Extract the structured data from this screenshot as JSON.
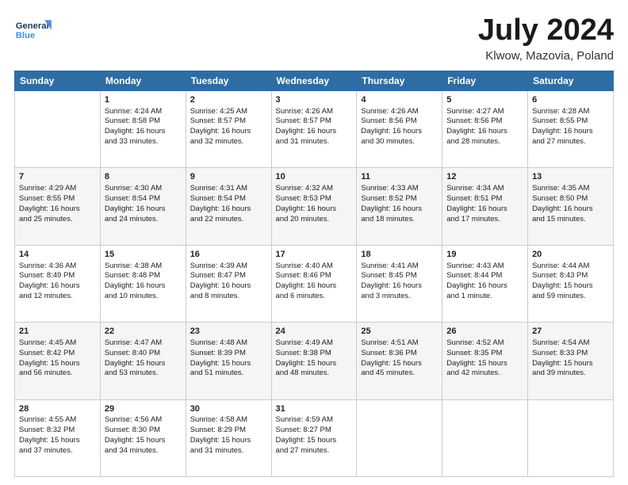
{
  "header": {
    "logo_line1": "General",
    "logo_line2": "Blue",
    "title": "July 2024",
    "location": "Klwow, Mazovia, Poland"
  },
  "weekdays": [
    "Sunday",
    "Monday",
    "Tuesday",
    "Wednesday",
    "Thursday",
    "Friday",
    "Saturday"
  ],
  "weeks": [
    [
      {
        "day": "",
        "content": ""
      },
      {
        "day": "1",
        "content": "Sunrise: 4:24 AM\nSunset: 8:58 PM\nDaylight: 16 hours\nand 33 minutes."
      },
      {
        "day": "2",
        "content": "Sunrise: 4:25 AM\nSunset: 8:57 PM\nDaylight: 16 hours\nand 32 minutes."
      },
      {
        "day": "3",
        "content": "Sunrise: 4:26 AM\nSunset: 8:57 PM\nDaylight: 16 hours\nand 31 minutes."
      },
      {
        "day": "4",
        "content": "Sunrise: 4:26 AM\nSunset: 8:56 PM\nDaylight: 16 hours\nand 30 minutes."
      },
      {
        "day": "5",
        "content": "Sunrise: 4:27 AM\nSunset: 8:56 PM\nDaylight: 16 hours\nand 28 minutes."
      },
      {
        "day": "6",
        "content": "Sunrise: 4:28 AM\nSunset: 8:55 PM\nDaylight: 16 hours\nand 27 minutes."
      }
    ],
    [
      {
        "day": "7",
        "content": "Sunrise: 4:29 AM\nSunset: 8:55 PM\nDaylight: 16 hours\nand 25 minutes."
      },
      {
        "day": "8",
        "content": "Sunrise: 4:30 AM\nSunset: 8:54 PM\nDaylight: 16 hours\nand 24 minutes."
      },
      {
        "day": "9",
        "content": "Sunrise: 4:31 AM\nSunset: 8:54 PM\nDaylight: 16 hours\nand 22 minutes."
      },
      {
        "day": "10",
        "content": "Sunrise: 4:32 AM\nSunset: 8:53 PM\nDaylight: 16 hours\nand 20 minutes."
      },
      {
        "day": "11",
        "content": "Sunrise: 4:33 AM\nSunset: 8:52 PM\nDaylight: 16 hours\nand 18 minutes."
      },
      {
        "day": "12",
        "content": "Sunrise: 4:34 AM\nSunset: 8:51 PM\nDaylight: 16 hours\nand 17 minutes."
      },
      {
        "day": "13",
        "content": "Sunrise: 4:35 AM\nSunset: 8:50 PM\nDaylight: 16 hours\nand 15 minutes."
      }
    ],
    [
      {
        "day": "14",
        "content": "Sunrise: 4:36 AM\nSunset: 8:49 PM\nDaylight: 16 hours\nand 12 minutes."
      },
      {
        "day": "15",
        "content": "Sunrise: 4:38 AM\nSunset: 8:48 PM\nDaylight: 16 hours\nand 10 minutes."
      },
      {
        "day": "16",
        "content": "Sunrise: 4:39 AM\nSunset: 8:47 PM\nDaylight: 16 hours\nand 8 minutes."
      },
      {
        "day": "17",
        "content": "Sunrise: 4:40 AM\nSunset: 8:46 PM\nDaylight: 16 hours\nand 6 minutes."
      },
      {
        "day": "18",
        "content": "Sunrise: 4:41 AM\nSunset: 8:45 PM\nDaylight: 16 hours\nand 3 minutes."
      },
      {
        "day": "19",
        "content": "Sunrise: 4:43 AM\nSunset: 8:44 PM\nDaylight: 16 hours\nand 1 minute."
      },
      {
        "day": "20",
        "content": "Sunrise: 4:44 AM\nSunset: 8:43 PM\nDaylight: 15 hours\nand 59 minutes."
      }
    ],
    [
      {
        "day": "21",
        "content": "Sunrise: 4:45 AM\nSunset: 8:42 PM\nDaylight: 15 hours\nand 56 minutes."
      },
      {
        "day": "22",
        "content": "Sunrise: 4:47 AM\nSunset: 8:40 PM\nDaylight: 15 hours\nand 53 minutes."
      },
      {
        "day": "23",
        "content": "Sunrise: 4:48 AM\nSunset: 8:39 PM\nDaylight: 15 hours\nand 51 minutes."
      },
      {
        "day": "24",
        "content": "Sunrise: 4:49 AM\nSunset: 8:38 PM\nDaylight: 15 hours\nand 48 minutes."
      },
      {
        "day": "25",
        "content": "Sunrise: 4:51 AM\nSunset: 8:36 PM\nDaylight: 15 hours\nand 45 minutes."
      },
      {
        "day": "26",
        "content": "Sunrise: 4:52 AM\nSunset: 8:35 PM\nDaylight: 15 hours\nand 42 minutes."
      },
      {
        "day": "27",
        "content": "Sunrise: 4:54 AM\nSunset: 8:33 PM\nDaylight: 15 hours\nand 39 minutes."
      }
    ],
    [
      {
        "day": "28",
        "content": "Sunrise: 4:55 AM\nSunset: 8:32 PM\nDaylight: 15 hours\nand 37 minutes."
      },
      {
        "day": "29",
        "content": "Sunrise: 4:56 AM\nSunset: 8:30 PM\nDaylight: 15 hours\nand 34 minutes."
      },
      {
        "day": "30",
        "content": "Sunrise: 4:58 AM\nSunset: 8:29 PM\nDaylight: 15 hours\nand 31 minutes."
      },
      {
        "day": "31",
        "content": "Sunrise: 4:59 AM\nSunset: 8:27 PM\nDaylight: 15 hours\nand 27 minutes."
      },
      {
        "day": "",
        "content": ""
      },
      {
        "day": "",
        "content": ""
      },
      {
        "day": "",
        "content": ""
      }
    ]
  ]
}
